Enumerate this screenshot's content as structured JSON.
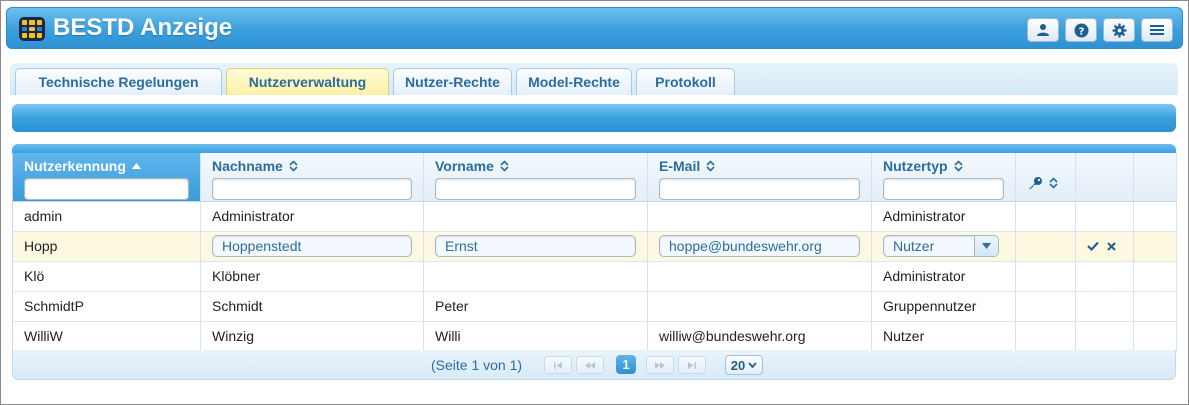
{
  "header": {
    "title": "BESTD Anzeige",
    "buttons": [
      "user-icon",
      "help-icon",
      "gear-icon",
      "menu-icon"
    ]
  },
  "tabs": [
    {
      "label": "Technische Regelungen",
      "active": false
    },
    {
      "label": "Nutzerverwaltung",
      "active": true
    },
    {
      "label": "Nutzer-Rechte",
      "active": false
    },
    {
      "label": "Model-Rechte",
      "active": false
    },
    {
      "label": "Protokoll",
      "active": false
    }
  ],
  "columns": {
    "nutzerkennung": "Nutzerkennung",
    "nachname": "Nachname",
    "vorname": "Vorname",
    "email": "E-Mail",
    "nutzertyp": "Nutzertyp"
  },
  "rows": [
    {
      "kennung": "admin",
      "nachname": "Administrator",
      "vorname": "",
      "email": "",
      "typ": "Administrator"
    },
    {
      "kennung": "Hopp",
      "nachname": "Hoppenstedt",
      "vorname": "Ernst",
      "email": "hoppe@bundeswehr.org",
      "typ": "Nutzer",
      "editing": true
    },
    {
      "kennung": "Klö",
      "nachname": "Klöbner",
      "vorname": "",
      "email": "",
      "typ": "Administrator"
    },
    {
      "kennung": "SchmidtP",
      "nachname": "Schmidt",
      "vorname": "Peter",
      "email": "",
      "typ": "Gruppennutzer"
    },
    {
      "kennung": "WilliW",
      "nachname": "Winzig",
      "vorname": "Willi",
      "email": "williw@bundeswehr.org",
      "typ": "Nutzer"
    }
  ],
  "pager": {
    "info": "(Seite 1 von 1)",
    "current_page": "1",
    "page_size": "20"
  },
  "colors": {
    "header_blue": "#3b9fdd",
    "tab_active": "#fdf1a6",
    "label_blue": "#2b6d9e"
  }
}
